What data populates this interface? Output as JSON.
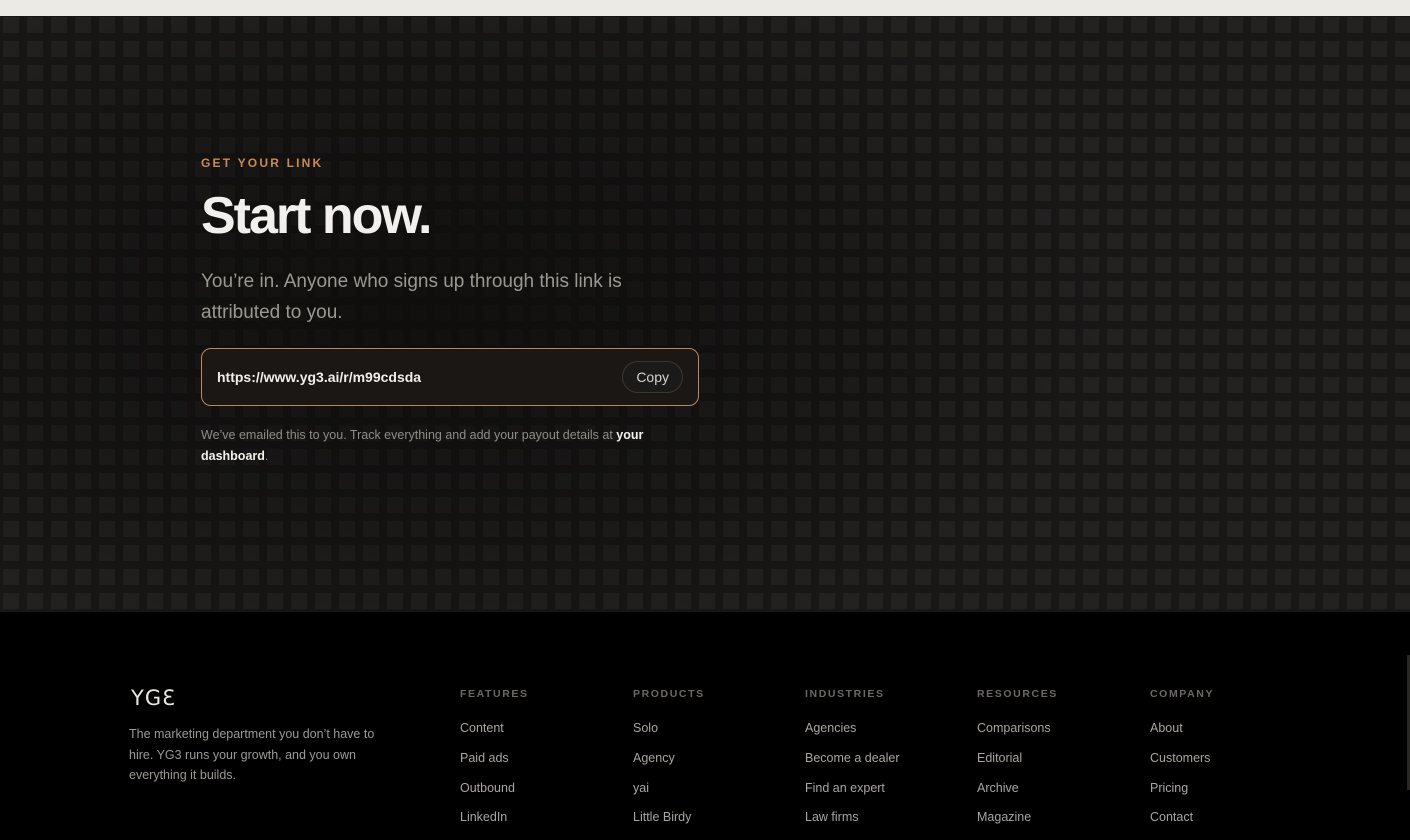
{
  "hero": {
    "eyebrow": "GET YOUR LINK",
    "headline": "Start now.",
    "subtext": "You’re in. Anyone who signs up through this link is attributed to you.",
    "link_url": "https://www.yg3.ai/r/m99cdsda",
    "copy_label": "Copy",
    "note_prefix": "We’ve emailed this to you. Track everything and add your payout details at ",
    "note_link": "your dashboard",
    "note_suffix": "."
  },
  "colors": {
    "accent": "#c98a55",
    "border_accent": "#b7895c",
    "background": "#0e0d0c"
  },
  "footer": {
    "logo": "YGƐ",
    "tagline": "The marketing department you don’t have to hire. YG3 runs your growth, and you own everything it builds.",
    "columns": [
      {
        "title": "FEATURES",
        "items": [
          "Content",
          "Paid ads",
          "Outbound",
          "LinkedIn"
        ]
      },
      {
        "title": "PRODUCTS",
        "items": [
          "Solo",
          "Agency",
          "yai",
          "Little Birdy"
        ]
      },
      {
        "title": "INDUSTRIES",
        "items": [
          "Agencies",
          "Become a dealer",
          "Find an expert",
          "Law firms"
        ]
      },
      {
        "title": "RESOURCES",
        "items": [
          "Comparisons",
          "Editorial",
          "Archive",
          "Magazine"
        ]
      },
      {
        "title": "COMPANY",
        "items": [
          "About",
          "Customers",
          "Pricing",
          "Contact"
        ]
      }
    ]
  }
}
